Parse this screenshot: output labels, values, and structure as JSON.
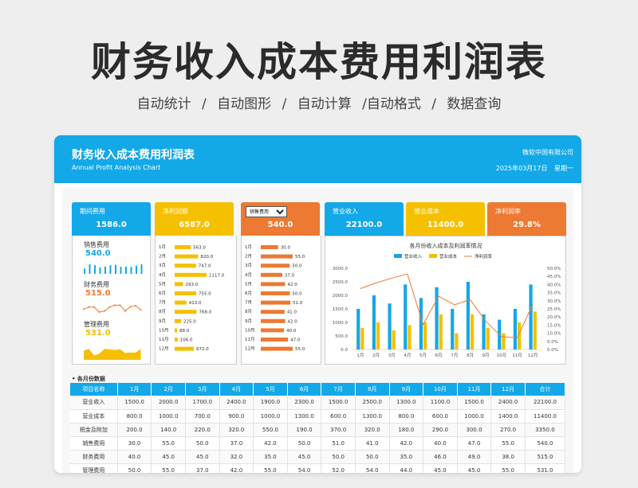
{
  "page": {
    "title": "财务收入成本费用利润表",
    "features": [
      "自动统计",
      "/",
      "自动图形",
      "/",
      "自动计算",
      "/自动格式",
      "/",
      "数据查询"
    ]
  },
  "header": {
    "title": "财务收入成本费用利润表",
    "subtitle": "Annual Profit Analysis Chart",
    "company": "微软中国有限公司",
    "date": "2025年03月17日",
    "weekday": "星期一"
  },
  "kpis": [
    {
      "label": "期间费用",
      "value": "1586.0",
      "color": "#13a8e8"
    },
    {
      "label": "净利润额",
      "value": "6587.0",
      "color": "#f5c000"
    },
    {
      "label": "销售费用",
      "value": "540.0",
      "color": "#ec7a33"
    },
    {
      "label": "营业收入",
      "value": "22100.0",
      "color": "#13a8e8"
    },
    {
      "label": "营业成本",
      "value": "11400.0",
      "color": "#f5c000"
    },
    {
      "label": "净利润率",
      "value": "29.8%",
      "color": "#ec7a33"
    }
  ],
  "mini": {
    "sales": {
      "label": "销售费用",
      "value": "540.0",
      "color": "#13a8e8"
    },
    "finance": {
      "label": "财务费用",
      "value": "515.0",
      "color": "#ec7a33"
    },
    "manage": {
      "label": "管理费用",
      "value": "531.0",
      "color": "#f5c000"
    }
  },
  "months": [
    "1月",
    "2月",
    "3月",
    "4月",
    "5月",
    "6月",
    "7月",
    "8月",
    "9月",
    "10月",
    "11月",
    "12月"
  ],
  "profit_bars": {
    "color": "#f5c000",
    "values": [
      563.0,
      820.0,
      747.0,
      1117.0,
      293.0,
      755.0,
      413.0,
      768.0,
      225.0,
      88.0,
      106.0,
      672.0
    ],
    "labels": [
      "563.0",
      "820.0",
      "747.0",
      "1117.0",
      "293.0",
      "755.0",
      "413.0",
      "768.0",
      "225.0",
      "88.0",
      "106.0",
      "672.0"
    ]
  },
  "sales_bars": {
    "color": "#ec7a33",
    "values": [
      30.0,
      55.0,
      50.0,
      37.0,
      42.0,
      50.0,
      51.0,
      41.0,
      42.0,
      40.0,
      47.0,
      55.0
    ],
    "labels": [
      "30.0",
      "55.0",
      "50.0",
      "37.0",
      "42.0",
      "50.0",
      "51.0",
      "41.0",
      "42.0",
      "40.0",
      "47.0",
      "55.0"
    ]
  },
  "chart_data": {
    "type": "bar",
    "title": "各月份收入成本及利润率情况",
    "categories": [
      "1月",
      "2月",
      "3月",
      "4月",
      "5月",
      "6月",
      "7月",
      "8月",
      "9月",
      "10月",
      "11月",
      "12月"
    ],
    "series": [
      {
        "name": "营业收入",
        "type": "bar",
        "color": "#13a8e8",
        "values": [
          1500,
          2000,
          1700,
          2400,
          1900,
          2300,
          1500,
          2500,
          1300,
          1100,
          1500,
          2400
        ]
      },
      {
        "name": "营业成本",
        "type": "bar",
        "color": "#f5c000",
        "values": [
          800,
          1000,
          700,
          900,
          1000,
          1300,
          600,
          1300,
          800,
          600,
          1000,
          1400
        ]
      },
      {
        "name": "净利润率",
        "type": "line",
        "axis": "right",
        "color": "#ec7a33",
        "values": [
          37.5,
          41.0,
          43.9,
          46.5,
          15.4,
          32.8,
          27.5,
          30.7,
          17.3,
          8.0,
          7.1,
          28.0
        ]
      }
    ],
    "ylim": [
      0,
      3000
    ],
    "yticks": [
      "0.0",
      "500.0",
      "1000.0",
      "1500.0",
      "2000.0",
      "2500.0",
      "3000.0"
    ],
    "y2lim": [
      0,
      50
    ],
    "y2ticks": [
      "0.0%",
      "5.0%",
      "10.0%",
      "15.0%",
      "20.0%",
      "25.0%",
      "30.0%",
      "35.0%",
      "40.0%",
      "45.0%",
      "50.0%"
    ],
    "legend": "top"
  },
  "section": {
    "title": "• 各月份数据"
  },
  "table": {
    "headers": [
      "项目名称",
      "1月",
      "2月",
      "3月",
      "4月",
      "5月",
      "6月",
      "7月",
      "8月",
      "9月",
      "10月",
      "11月",
      "12月",
      "合计"
    ],
    "rows": [
      [
        "营业收入",
        "1500.0",
        "2000.0",
        "1700.0",
        "2400.0",
        "1900.0",
        "2300.0",
        "1500.0",
        "2500.0",
        "1300.0",
        "1100.0",
        "1500.0",
        "2400.0",
        "22100.0"
      ],
      [
        "营业成本",
        "800.0",
        "1000.0",
        "700.0",
        "900.0",
        "1000.0",
        "1300.0",
        "600.0",
        "1300.0",
        "800.0",
        "600.0",
        "1000.0",
        "1400.0",
        "11400.0"
      ],
      [
        "税金及附加",
        "200.0",
        "140.0",
        "220.0",
        "320.0",
        "550.0",
        "190.0",
        "370.0",
        "320.0",
        "180.0",
        "290.0",
        "300.0",
        "270.0",
        "3350.0"
      ],
      [
        "销售费用",
        "30.0",
        "55.0",
        "50.0",
        "37.0",
        "42.0",
        "50.0",
        "51.0",
        "41.0",
        "42.0",
        "40.0",
        "47.0",
        "55.0",
        "540.0"
      ],
      [
        "财务费用",
        "40.0",
        "45.0",
        "45.0",
        "32.0",
        "35.0",
        "45.0",
        "50.0",
        "50.0",
        "35.0",
        "46.0",
        "49.0",
        "38.0",
        "515.0"
      ],
      [
        "管理费用",
        "50.0",
        "55.0",
        "37.0",
        "42.0",
        "55.0",
        "54.0",
        "52.0",
        "54.0",
        "44.0",
        "45.0",
        "45.0",
        "55.0",
        "531.0"
      ]
    ]
  }
}
